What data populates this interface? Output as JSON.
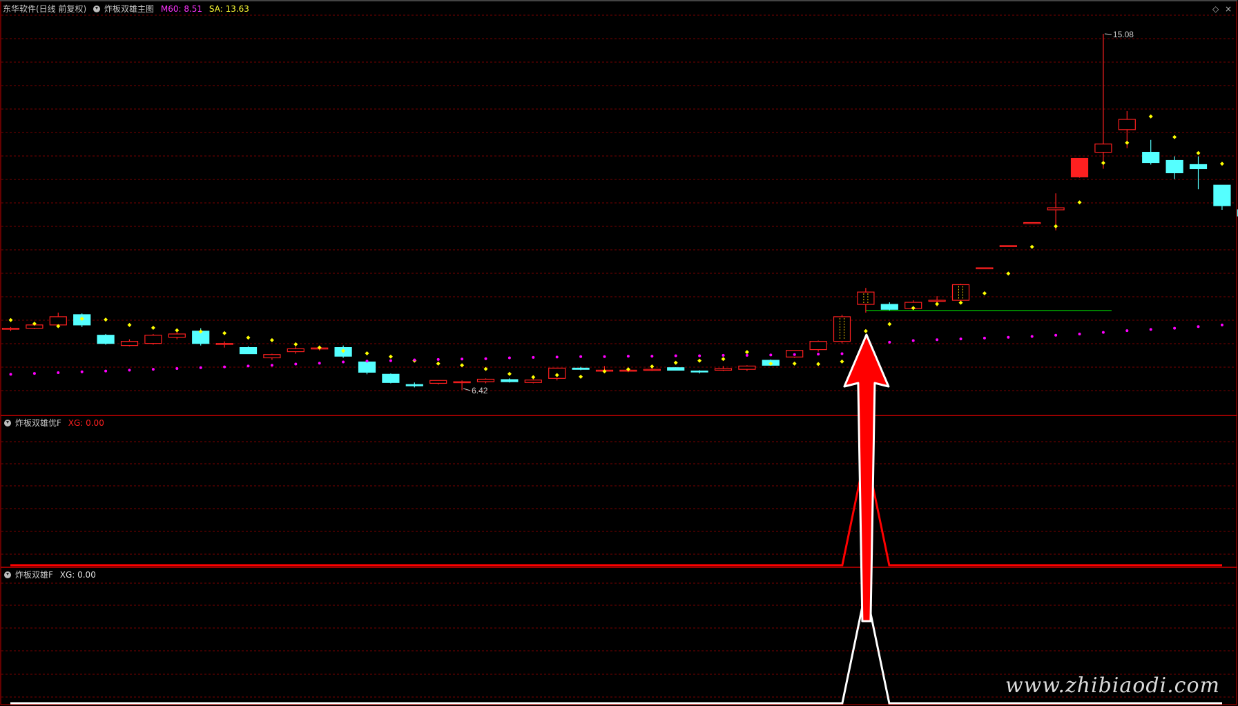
{
  "header": {
    "app": "东华软件(日线 前复权)",
    "indicator": "炸板双雄主图",
    "m60_label": "M60: 8.51",
    "sa_label": "SA: 13.63"
  },
  "panel2": {
    "title": "炸板双雄优F",
    "value": "XG: 0.00"
  },
  "panel3": {
    "title": "炸板双雄F",
    "value": "XG: 0.00"
  },
  "corner": {
    "diamond": "◇",
    "close": "×"
  },
  "annotations": {
    "high_label": "15.08",
    "low_label": "6.42"
  },
  "watermark": "www.zhibiaodi.com",
  "colors": {
    "up": "#ff2020",
    "down": "#55ffff",
    "yellow_dots": "#ffff00",
    "magenta_dots": "#ff00ff",
    "grid": "#7a0000",
    "arrow": "#ff0000",
    "green_line": "#00ff00",
    "signal_red": "#ff0000",
    "signal_white": "#ffffff"
  },
  "chart_data": [
    {
      "type": "candlestick",
      "title": "炸板双雄主图",
      "ylim": [
        6.0,
        15.5
      ],
      "ohlc": [
        [
          7.9,
          7.95,
          7.85,
          7.92
        ],
        [
          7.92,
          8.05,
          7.9,
          8.0
        ],
        [
          8.0,
          8.3,
          7.95,
          8.2
        ],
        [
          8.25,
          8.28,
          7.95,
          8.0
        ],
        [
          7.75,
          7.78,
          7.52,
          7.55
        ],
        [
          7.5,
          7.65,
          7.48,
          7.6
        ],
        [
          7.55,
          7.78,
          7.52,
          7.75
        ],
        [
          7.7,
          7.85,
          7.65,
          7.78
        ],
        [
          7.85,
          7.92,
          7.5,
          7.55
        ],
        [
          7.55,
          7.6,
          7.45,
          7.55
        ],
        [
          7.45,
          7.48,
          7.3,
          7.3
        ],
        [
          7.2,
          7.3,
          7.15,
          7.28
        ],
        [
          7.35,
          7.48,
          7.3,
          7.42
        ],
        [
          7.44,
          7.5,
          7.38,
          7.44
        ],
        [
          7.45,
          7.5,
          7.2,
          7.24
        ],
        [
          7.1,
          7.12,
          6.8,
          6.85
        ],
        [
          6.8,
          6.82,
          6.58,
          6.6
        ],
        [
          6.55,
          6.6,
          6.48,
          6.52
        ],
        [
          6.58,
          6.65,
          6.55,
          6.65
        ],
        [
          6.62,
          6.65,
          6.42,
          6.62
        ],
        [
          6.62,
          6.7,
          6.58,
          6.68
        ],
        [
          6.67,
          6.7,
          6.6,
          6.62
        ],
        [
          6.6,
          6.68,
          6.58,
          6.66
        ],
        [
          6.7,
          6.95,
          6.65,
          6.95
        ],
        [
          6.95,
          6.98,
          6.9,
          6.92
        ],
        [
          6.9,
          7.0,
          6.85,
          6.9
        ],
        [
          6.88,
          6.92,
          6.85,
          6.9
        ],
        [
          6.92,
          6.95,
          6.88,
          6.92
        ],
        [
          6.96,
          6.97,
          6.9,
          6.9
        ],
        [
          6.88,
          6.9,
          6.82,
          6.86
        ],
        [
          6.9,
          7.0,
          6.88,
          6.94
        ],
        [
          6.92,
          7.02,
          6.88,
          7.0
        ],
        [
          7.14,
          7.16,
          7.01,
          7.02
        ],
        [
          7.22,
          7.38,
          7.2,
          7.38
        ],
        [
          7.4,
          7.62,
          7.35,
          7.6
        ],
        [
          7.6,
          8.25,
          7.55,
          8.2
        ],
        [
          8.5,
          8.9,
          8.3,
          8.8
        ],
        [
          8.5,
          8.55,
          8.35,
          8.38
        ],
        [
          8.4,
          8.6,
          8.38,
          8.55
        ],
        [
          8.6,
          8.7,
          8.45,
          8.6
        ],
        [
          8.6,
          9.0,
          8.58,
          8.98
        ],
        [
          9.38,
          9.39,
          9.37,
          9.39
        ],
        [
          9.92,
          9.93,
          9.91,
          9.93
        ],
        [
          10.48,
          10.49,
          10.47,
          10.49
        ],
        [
          10.8,
          11.2,
          10.3,
          10.85
        ],
        [
          11.6,
          12.05,
          11.58,
          12.05
        ],
        [
          12.2,
          15.08,
          11.8,
          12.4
        ],
        [
          12.75,
          13.2,
          12.3,
          13.0
        ],
        [
          12.2,
          12.5,
          11.9,
          11.95
        ],
        [
          12.0,
          12.1,
          11.55,
          11.7
        ],
        [
          11.9,
          12.1,
          11.3,
          11.8
        ],
        [
          11.4,
          11.4,
          10.8,
          10.9
        ],
        [
          10.8,
          10.9,
          10.55,
          10.65
        ]
      ],
      "yellow_dots": [
        8.12,
        8.03,
        7.97,
        8.15,
        8.13,
        8.0,
        7.93,
        7.87,
        7.84,
        7.8,
        7.69,
        7.63,
        7.53,
        7.45,
        7.37,
        7.31,
        7.23,
        7.13,
        7.06,
        7.02,
        6.93,
        6.81,
        6.73,
        6.78,
        6.74,
        6.87,
        6.92,
        6.99,
        7.08,
        7.13,
        7.17,
        7.34,
        7.06,
        7.06,
        7.05,
        7.11,
        7.85,
        8.02,
        8.41,
        8.51,
        8.54,
        8.77,
        9.25,
        9.9,
        10.4,
        10.98,
        11.94,
        12.43,
        13.07,
        12.57,
        12.18,
        11.92,
        11.58
      ],
      "magenta_dots": [
        6.8,
        6.82,
        6.84,
        6.86,
        6.88,
        6.9,
        6.92,
        6.94,
        6.96,
        6.98,
        7.0,
        7.02,
        7.05,
        7.07,
        7.1,
        7.12,
        7.13,
        7.15,
        7.16,
        7.17,
        7.18,
        7.2,
        7.21,
        7.22,
        7.23,
        7.23,
        7.24,
        7.24,
        7.25,
        7.25,
        7.26,
        7.26,
        7.27,
        7.28,
        7.29,
        7.3,
        7.45,
        7.58,
        7.62,
        7.64,
        7.66,
        7.68,
        7.7,
        7.72,
        7.75,
        7.78,
        7.82,
        7.86,
        7.89,
        7.92,
        7.96,
        8.0,
        8.06
      ],
      "support_level": 8.35,
      "high": 15.08,
      "low": 6.42
    },
    {
      "type": "line",
      "title": "炸板双雄优F",
      "series": [
        {
          "name": "XG",
          "signal_at_index": 36,
          "peak": 1
        }
      ]
    },
    {
      "type": "line",
      "title": "炸板双雄F",
      "series": [
        {
          "name": "XG",
          "signal_at_index": 36,
          "peak": 1
        }
      ]
    }
  ]
}
